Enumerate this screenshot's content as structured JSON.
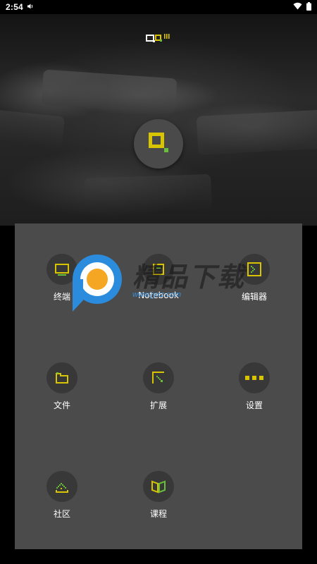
{
  "status_bar": {
    "time": "2:54"
  },
  "icons": {
    "top_logo": "pixel-logo-icon",
    "center_logo": "app-logo-icon",
    "watermark_logo": "watermark-p-logo-icon"
  },
  "colors": {
    "accent": "#d8c400",
    "green": "#6abf3a",
    "panel": "#4b4b4b",
    "tile_bg": "#383838"
  },
  "menu": {
    "items": [
      {
        "label": "终端",
        "icon": "terminal-icon"
      },
      {
        "label": "Notebook",
        "icon": "notebook-icon"
      },
      {
        "label": "编辑器",
        "icon": "editor-icon"
      },
      {
        "label": "文件",
        "icon": "folder-icon"
      },
      {
        "label": "扩展",
        "icon": "extension-icon"
      },
      {
        "label": "设置",
        "icon": "settings-icon"
      },
      {
        "label": "社区",
        "icon": "community-icon"
      },
      {
        "label": "课程",
        "icon": "book-icon"
      }
    ]
  },
  "watermark": {
    "title": "精品下载",
    "url": "www.jyxz.com"
  }
}
